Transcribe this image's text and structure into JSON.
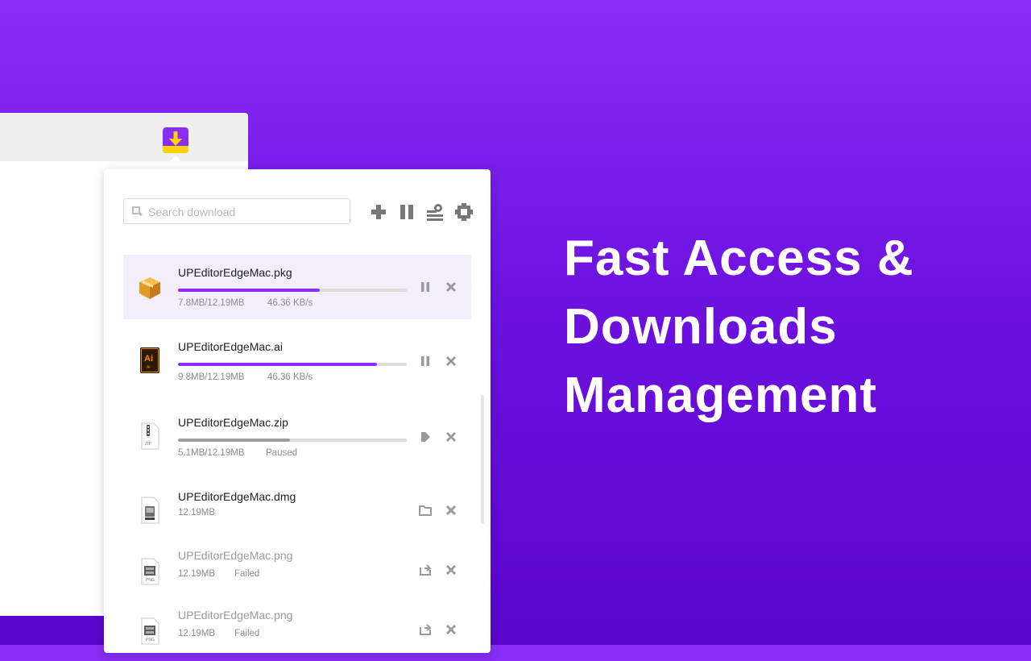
{
  "headline": {
    "line1": "Fast Access &",
    "line2": "Downloads",
    "line3": "Management"
  },
  "search": {
    "placeholder": "Search download"
  },
  "colors": {
    "accent": "#8a2df7",
    "paused_bar": "#9e9e9e",
    "tray": "#ffd200"
  },
  "toolbar": {
    "add_icon": "plus-icon",
    "pause_all_icon": "pause-icon",
    "clear_icon": "clear-list-icon",
    "settings_icon": "gear-icon"
  },
  "downloads": [
    {
      "name": "UPEditorEdgeMac.pkg",
      "size": "7.8MB/12.19MB",
      "status": "46.36 KB/s",
      "progress": 0.62,
      "state": "downloading",
      "icon": "package-icon"
    },
    {
      "name": "UPEditorEdgeMac.ai",
      "size": "9.8MB/12.19MB",
      "status": "46.36 KB/s",
      "progress": 0.87,
      "state": "downloading",
      "icon": "illustrator-file-icon"
    },
    {
      "name": "UPEditorEdgeMac.zip",
      "size": "5.1MB/12.19MB",
      "status": "Paused",
      "progress": 0.49,
      "state": "paused",
      "icon": "zip-file-icon"
    },
    {
      "name": "UPEditorEdgeMac.dmg",
      "size": "12.19MB",
      "status": "",
      "state": "complete",
      "icon": "disk-image-icon"
    },
    {
      "name": "UPEditorEdgeMac.png",
      "size": "12.19MB",
      "status": "Failed",
      "state": "failed",
      "icon": "png-file-icon"
    },
    {
      "name": "UPEditorEdgeMac.png",
      "size": "12.19MB",
      "status": "Failed",
      "state": "failed",
      "icon": "png-file-icon"
    }
  ]
}
